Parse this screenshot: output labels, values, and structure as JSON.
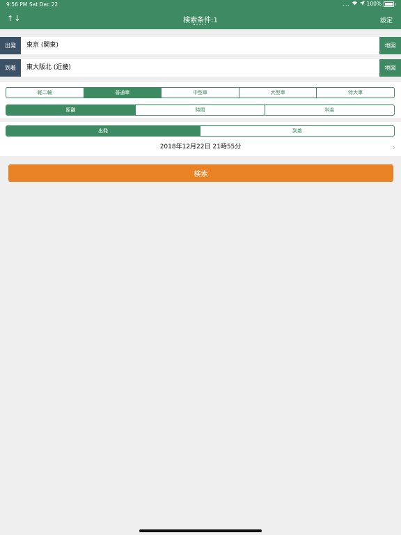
{
  "status_bar": {
    "time": "9:56 PM",
    "date": "Sat Dec 22",
    "battery": "100%"
  },
  "header": {
    "swap_label": "↑↓",
    "title": "検索条件:1",
    "settings_label": "設定",
    "page_count": 5,
    "page_active": 1
  },
  "departure": {
    "tag": "出発",
    "station": "東京 (関東)",
    "map_label": "地図"
  },
  "arrival": {
    "tag": "到着",
    "station": "東大阪北 (近畿)",
    "map_label": "地図"
  },
  "vehicle_types": [
    "軽二輪",
    "普通車",
    "中型車",
    "大型車",
    "特大車"
  ],
  "vehicle_selected": 1,
  "route_priority": [
    "距離",
    "時間",
    "料金"
  ],
  "route_selected": 0,
  "time_mode": [
    "出発",
    "到着"
  ],
  "time_mode_selected": 0,
  "datetime": "2018年12月22日 21時55分",
  "search_label": "検索",
  "colors": {
    "primary_green": "#3e8a62",
    "tag_navy": "#3b5166",
    "search_orange": "#e88224",
    "background": "#efefef"
  }
}
